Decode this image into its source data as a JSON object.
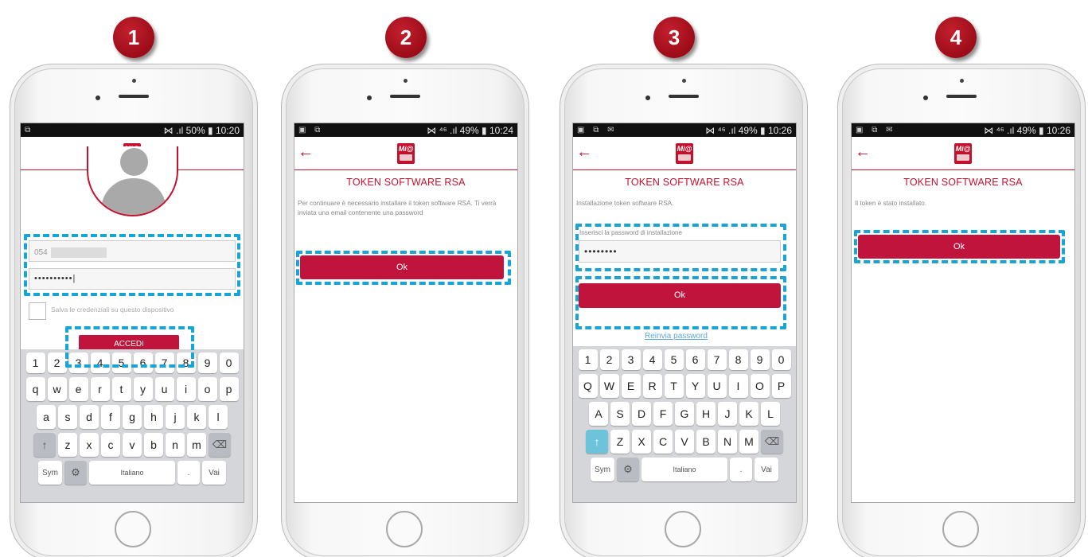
{
  "steps": [
    "1",
    "2",
    "3",
    "4"
  ],
  "colors": {
    "accent": "#c7102e",
    "button": "#c1143c",
    "highlight": "#19a4d6"
  },
  "phone1": {
    "status_left": "⧉",
    "status_right": "⋈ .ıl 50% ▮ 10:20",
    "username_value": "054",
    "password_value": "••••••••••|",
    "remember_label": "Salva le credenziali su questo dispositivo",
    "login_button": "ACCEDI"
  },
  "phone2": {
    "status_left": "▣ ⧉",
    "status_right": "⋈ ⁴⁶ .ıl 49% ▮ 10:24",
    "title": "TOKEN SOFTWARE RSA",
    "message": "Per continuare è necessario installare il token software RSA. Ti verrà inviata una email contenente una password",
    "ok_button": "Ok"
  },
  "phone3": {
    "status_left": "▣ ⧉ ✉",
    "status_right": "⋈ ⁴⁶ .ıl 49% ▮ 10:26",
    "title": "TOKEN SOFTWARE RSA",
    "message": "Installazione token software RSA.",
    "password_label": "Inserisci la password di installazione",
    "password_value": "••••••••",
    "ok_button": "Ok",
    "resend_link": "Reinvia password"
  },
  "phone4": {
    "status_left": "▣ ⧉ ✉",
    "status_right": "⋈ ⁴⁶ .ıl 49% ▮ 10:26",
    "title": "TOKEN SOFTWARE RSA",
    "message": "Il token è stato installato.",
    "ok_button": "Ok"
  },
  "keyboard_lower": {
    "row1": [
      "1",
      "2",
      "3",
      "4",
      "5",
      "6",
      "7",
      "8",
      "9",
      "0"
    ],
    "row2": [
      "q",
      "w",
      "e",
      "r",
      "t",
      "y",
      "u",
      "i",
      "o",
      "p"
    ],
    "row3": [
      "a",
      "s",
      "d",
      "f",
      "g",
      "h",
      "j",
      "k",
      "l"
    ],
    "row4": [
      "z",
      "x",
      "c",
      "v",
      "b",
      "n",
      "m"
    ],
    "sym": "Sym",
    "space": "Italiano",
    "go": "Vai",
    "shift_icon": "↑",
    "backspace_icon": "⌫",
    "settings_icon": "⚙",
    "dot": "."
  },
  "keyboard_upper": {
    "row1": [
      "1",
      "2",
      "3",
      "4",
      "5",
      "6",
      "7",
      "8",
      "9",
      "0"
    ],
    "row2": [
      "Q",
      "W",
      "E",
      "R",
      "T",
      "Y",
      "U",
      "I",
      "O",
      "P"
    ],
    "row3": [
      "A",
      "S",
      "D",
      "F",
      "G",
      "H",
      "J",
      "K",
      "L"
    ],
    "row4": [
      "Z",
      "X",
      "C",
      "V",
      "B",
      "N",
      "M"
    ],
    "sym": "Sym",
    "space": "Italiano",
    "go": "Vai",
    "shift_icon": "↑",
    "backspace_icon": "⌫",
    "settings_icon": "⚙",
    "dot": "."
  }
}
